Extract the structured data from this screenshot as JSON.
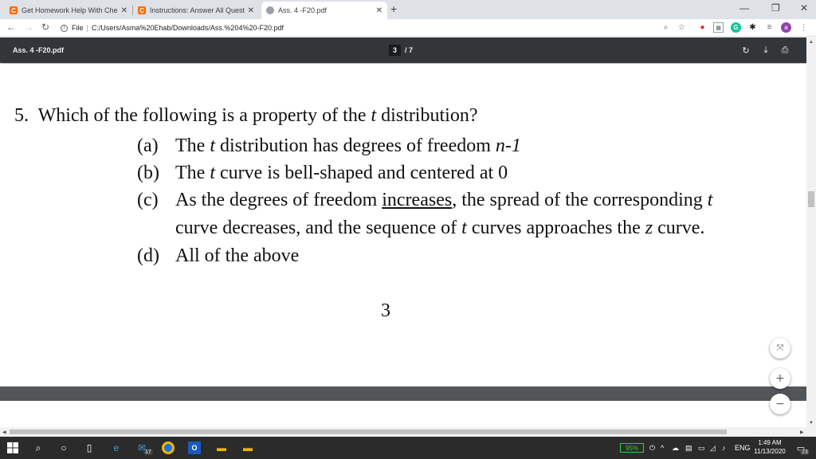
{
  "browser": {
    "tabs": [
      {
        "title": "Get Homework Help With Chegg",
        "favicon": "C"
      },
      {
        "title": "Instructions: Answer All Question",
        "favicon": "C"
      },
      {
        "title": "Ass. 4 -F20.pdf",
        "favicon": "globe"
      }
    ],
    "close_glyph": "✕",
    "new_tab_glyph": "+",
    "minimize_glyph": "—",
    "restore_glyph": "❐",
    "close_window_glyph": "✕",
    "address": {
      "scheme_label": "File",
      "url": "C:/Users/Asma%20Ehab/Downloads/Ass.%204%20-F20.pdf"
    },
    "profile_initial": "a",
    "accent_color": "#1a73e8"
  },
  "pdf": {
    "title": "Ass. 4 -F20.pdf",
    "current_page": "3",
    "total_pages": "/  7",
    "icons": [
      "rotate-icon",
      "download-icon",
      "print-icon"
    ]
  },
  "document": {
    "question_number": "5.",
    "question_text_before": "Which of the following is a property of the ",
    "question_text_t": "t",
    "question_text_after": " distribution?",
    "options": {
      "a": {
        "label": "(a)",
        "pre": "The ",
        "t": "t",
        "post": " distribution has degrees of freedom ",
        "math": "n-1"
      },
      "b": {
        "label": "(b)",
        "pre": "The ",
        "t": "t",
        "post": " curve is bell-shaped and centered at 0"
      },
      "c": {
        "label": "(c)",
        "pre": "As the degrees of freedom ",
        "underlined": "increases",
        "mid": ", the spread of the corresponding ",
        "t": "t",
        "line2_pre": "curve decreases, and the sequence of ",
        "t2": "t",
        "line2_mid": " curves approaches the ",
        "z": "z",
        "line2_post": " curve."
      },
      "d": {
        "label": "(d)",
        "text": "All of the above"
      }
    },
    "page_number": "3"
  },
  "zoom": {
    "fit_glyph": "⤧",
    "zoom_in_glyph": "+",
    "zoom_out_glyph": "−"
  },
  "taskbar": {
    "battery": "95%",
    "language": "ENG",
    "time": "1:49 AM",
    "date": "11/13/2020",
    "mail_badge": "17",
    "notification_badge": "23"
  }
}
